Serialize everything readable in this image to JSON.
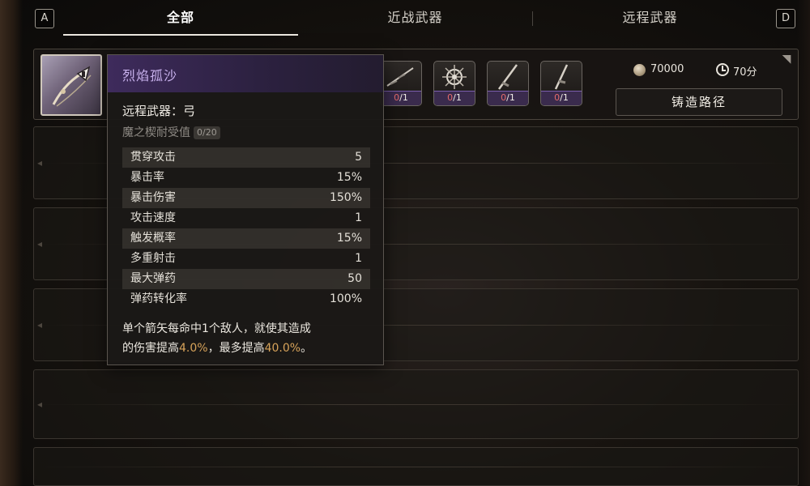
{
  "tabs": {
    "key_left": "A",
    "key_right": "D",
    "items": [
      {
        "label": "全部"
      },
      {
        "label": "近战武器"
      },
      {
        "label": "远程武器"
      }
    ],
    "active": "全部"
  },
  "selected_weapon": {
    "materials": [
      {
        "have": "0",
        "need": "/1"
      },
      {
        "have": "0",
        "need": "/1"
      },
      {
        "have": "0",
        "need": "/1"
      },
      {
        "have": "0",
        "need": "/1"
      }
    ],
    "cost": "70000",
    "time": "70分",
    "forge_button": "铸造路径"
  },
  "tooltip": {
    "name": "烈焰孤沙",
    "type_line": "远程武器：弓",
    "endurance_label": "魔之楔耐受值",
    "endurance_value": "0/20",
    "stats": [
      {
        "label": "贯穿攻击",
        "value": "5"
      },
      {
        "label": "暴击率",
        "value": "15%"
      },
      {
        "label": "暴击伤害",
        "value": "150%"
      },
      {
        "label": "攻击速度",
        "value": "1"
      },
      {
        "label": "触发概率",
        "value": "15%"
      },
      {
        "label": "多重射击",
        "value": "1"
      },
      {
        "label": "最大弹药",
        "value": "50"
      },
      {
        "label": "弹药转化率",
        "value": "100%"
      }
    ],
    "description": {
      "line1": "单个箭矢每命中1个敌人，就使其造成",
      "line2_pre": "的伤害提高",
      "highlight1": "4.0%",
      "line2_mid": "，最多提高",
      "highlight2": "40.0%",
      "line2_post": "。"
    }
  },
  "colors": {
    "accent_purple": "#7c5fb0",
    "name_purple": "#c9b2ee",
    "highlight_gold": "#d7a35a",
    "count_red": "#e36b6b"
  },
  "icons": {
    "coin": "coin-icon",
    "clock": "clock-icon",
    "pin": "pin-icon"
  }
}
